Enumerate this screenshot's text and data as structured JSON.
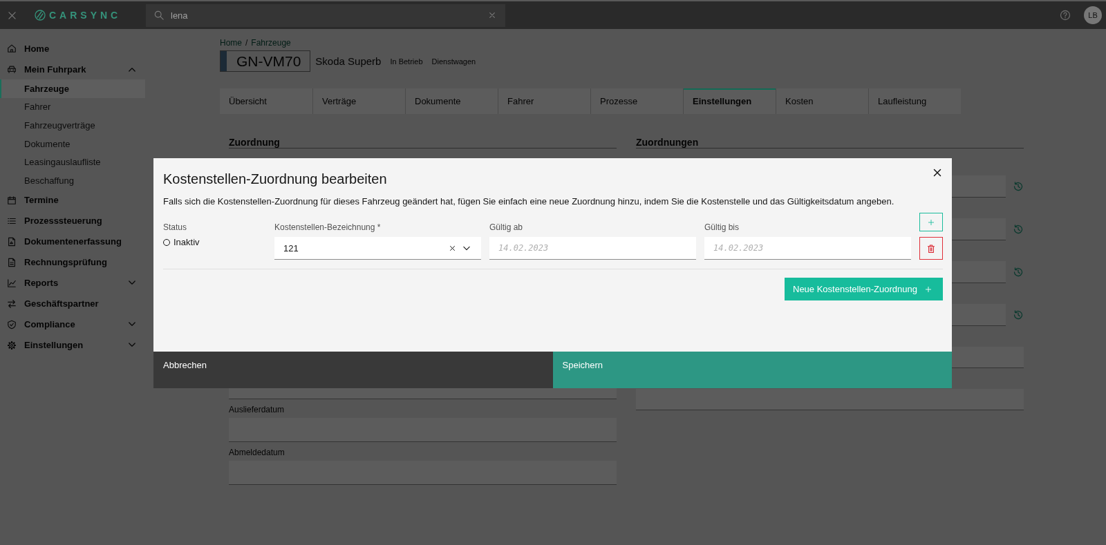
{
  "top_bar": {
    "logo": "CARSYNC",
    "search": {
      "value": "lena"
    },
    "avatar": "LB"
  },
  "sidebar": {
    "items": [
      {
        "label": "Home",
        "selected": false
      },
      {
        "label": "Mein Fuhrpark",
        "selected": false,
        "expanded": true,
        "children": [
          {
            "label": "Fahrzeuge",
            "selected": true
          },
          {
            "label": "Fahrer",
            "selected": false
          },
          {
            "label": "Fahrzeugverträge",
            "selected": false
          },
          {
            "label": "Dokumente",
            "selected": false
          },
          {
            "label": "Leasingauslaufliste",
            "selected": false
          },
          {
            "label": "Beschaffung",
            "selected": false
          }
        ]
      },
      {
        "label": "Termine",
        "selected": false
      },
      {
        "label": "Prozesssteuerung",
        "selected": false
      },
      {
        "label": "Dokumentenerfassung",
        "selected": false
      },
      {
        "label": "Rechnungsprüfung",
        "selected": false
      },
      {
        "label": "Reports",
        "selected": false,
        "expanded": false
      },
      {
        "label": "Geschäftspartner",
        "selected": false
      },
      {
        "label": "Compliance",
        "selected": false,
        "expanded": false
      },
      {
        "label": "Einstellungen",
        "selected": false,
        "expanded": false
      }
    ]
  },
  "breadcrumb": {
    "items": [
      "Home",
      "Fahrzeuge"
    ],
    "separator": "/"
  },
  "vehicle": {
    "plate": "GN-VM70",
    "model": "Skoda Superb",
    "tags": [
      "In Betrieb",
      "Dienstwagen"
    ]
  },
  "tabs": [
    {
      "label": "Übersicht",
      "selected": false
    },
    {
      "label": "Verträge",
      "selected": false
    },
    {
      "label": "Dokumente",
      "selected": false
    },
    {
      "label": "Fahrer",
      "selected": false
    },
    {
      "label": "Prozesse",
      "selected": false
    },
    {
      "label": "Einstellungen",
      "selected": true
    },
    {
      "label": "Kosten",
      "selected": false
    },
    {
      "label": "Laufleistung",
      "selected": false
    }
  ],
  "left_panel": {
    "title": "Zuordnung",
    "fields": [
      {
        "label": "Auslieferdatum"
      },
      {
        "label": "Abmeldedatum"
      }
    ]
  },
  "right_panel": {
    "title": "Zuordnungen",
    "rows": [
      {
        "history_button": true
      },
      {
        "history_button": true
      },
      {
        "history_button": true
      },
      {
        "history_button": true
      }
    ]
  },
  "modal": {
    "title": "Kostenstellen-Zuordnung bearbeiten",
    "description": "Falls sich die Kostenstellen-Zuordnung für dieses Fahrzeug geändert hat, fügen Sie einfach eine neue Zuordnung hinzu, indem Sie die Kostenstelle und das Gültigkeitsdatum angeben.",
    "assignments": [
      {
        "status": {
          "label": "Status",
          "options": [
            {
              "label": "Inaktiv",
              "selected": false
            }
          ]
        },
        "cost_center": {
          "label": "Kostenstellen-Bezeichnung *",
          "value": "121"
        },
        "valid_from": {
          "label": "Gültig ab",
          "placeholder": "14.02.2023"
        },
        "valid_to": {
          "label": "Gültig bis",
          "placeholder": "14.02.2023"
        }
      }
    ],
    "add_button": "Neue Kostenstellen-Zuordnung",
    "footer": {
      "cancel": "Abbrechen",
      "save": "Speichern"
    }
  }
}
